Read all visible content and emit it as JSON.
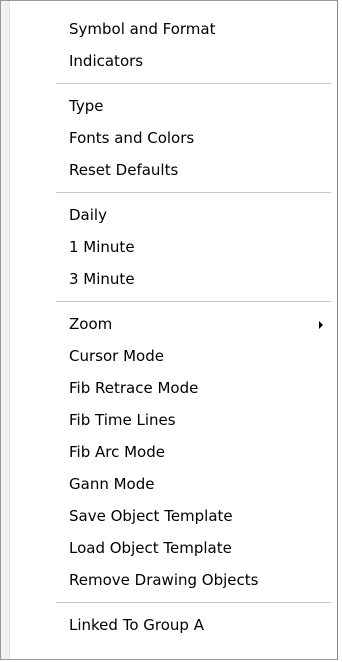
{
  "menu": {
    "groups": [
      {
        "items": [
          {
            "label": "Symbol and Format"
          },
          {
            "label": "Indicators"
          }
        ]
      },
      {
        "items": [
          {
            "label": "Type"
          },
          {
            "label": "Fonts and Colors"
          },
          {
            "label": "Reset Defaults"
          }
        ]
      },
      {
        "items": [
          {
            "label": "Daily"
          },
          {
            "label": "1 Minute"
          },
          {
            "label": "3 Minute"
          }
        ]
      },
      {
        "items": [
          {
            "label": "Zoom",
            "submenu_icon": "submenu-arrow-icon"
          },
          {
            "label": "Cursor Mode"
          },
          {
            "label": "Fib Retrace Mode"
          },
          {
            "label": "Fib Time Lines"
          },
          {
            "label": "Fib Arc Mode"
          },
          {
            "label": "Gann Mode"
          },
          {
            "label": "Save Object Template"
          },
          {
            "label": "Load Object Template"
          },
          {
            "label": "Remove Drawing Objects"
          }
        ]
      },
      {
        "items": [
          {
            "label": "Linked To Group A"
          }
        ]
      }
    ]
  }
}
